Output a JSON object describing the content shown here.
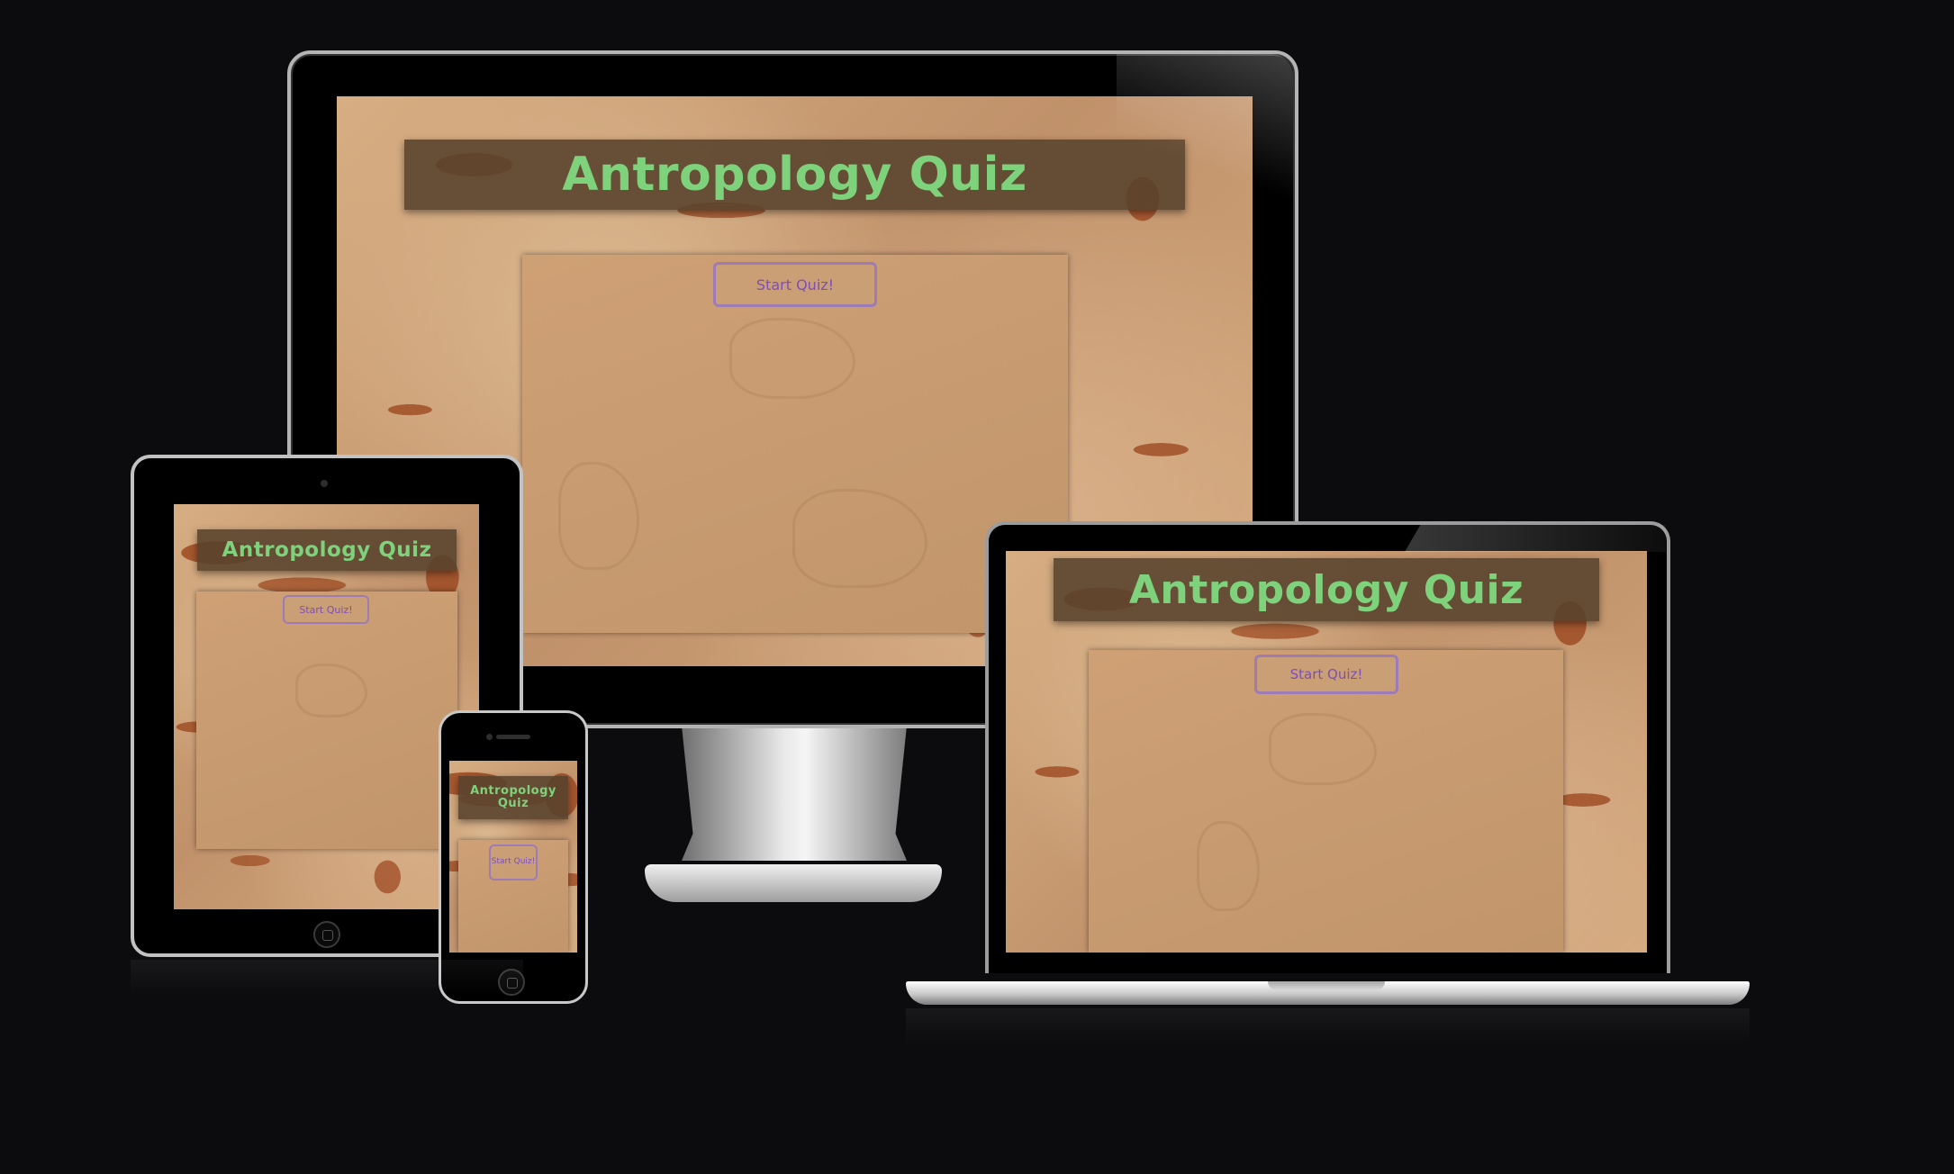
{
  "app": {
    "title": "Antropology Quiz",
    "start_button_label": "Start Quiz!"
  },
  "colors": {
    "background": "#0c0b0d",
    "title_text": "#7fd27c",
    "title_band": "#58422c",
    "button_text": "#7d4fb4",
    "button_border": "#9d7bb6",
    "card": "#c79a70"
  },
  "devices": {
    "desktop": {
      "title": "Antropology Quiz",
      "start_label": "Start Quiz!"
    },
    "tablet": {
      "title": "Antropology Quiz",
      "start_label": "Start Quiz!"
    },
    "phone": {
      "title": "Antropology Quiz",
      "start_label": "Start Quiz!"
    },
    "laptop": {
      "title": "Antropology Quiz",
      "start_label": "Start Quiz!"
    }
  }
}
